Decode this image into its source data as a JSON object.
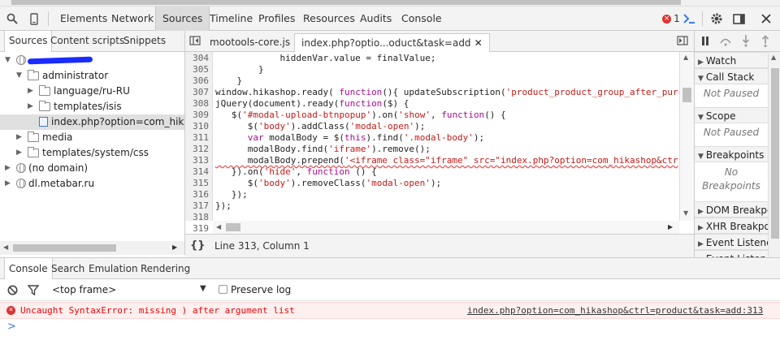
{
  "toolbar": {
    "tabs": [
      "Elements",
      "Network",
      "Sources",
      "Timeline",
      "Profiles",
      "Resources",
      "Audits",
      "Console"
    ],
    "active_tab": "Sources",
    "error_count": "1"
  },
  "navigator": {
    "tabs": [
      "Sources",
      "Content scripts",
      "Snippets"
    ],
    "tree": [
      {
        "label": "",
        "type": "globe",
        "indent": 0,
        "open": true,
        "redacted": true
      },
      {
        "label": "administrator",
        "type": "folder",
        "indent": 1,
        "open": true
      },
      {
        "label": "language/ru-RU",
        "type": "folder",
        "indent": 2,
        "open": false
      },
      {
        "label": "templates/isis",
        "type": "folder",
        "indent": 2,
        "open": false
      },
      {
        "label": "index.php?option=com_hikasho",
        "type": "file",
        "indent": 2,
        "selected": true
      },
      {
        "label": "media",
        "type": "folder",
        "indent": 1,
        "open": false
      },
      {
        "label": "templates/system/css",
        "type": "folder",
        "indent": 1,
        "open": false
      },
      {
        "label": "(no domain)",
        "type": "globe",
        "indent": 0,
        "open": false
      },
      {
        "label": "dl.metabar.ru",
        "type": "globe",
        "indent": 0,
        "open": false
      }
    ]
  },
  "editor": {
    "tabs": [
      "mootools-core.js",
      "index.php?optio...oduct&task=add"
    ],
    "active_tab_index": 1,
    "status": "Line 313, Column 1",
    "error_line": 313,
    "lines": [
      {
        "n": "304",
        "html": "            hiddenVar.value = finalValue;"
      },
      {
        "n": "305",
        "html": "        }"
      },
      {
        "n": "306",
        "html": "    }"
      },
      {
        "n": "307",
        "html": "window.hikashop.ready( <span class=\"kw\">function</span>(){ updateSubscription(<span class=\"str\">'product_product_group_after_purc</span>"
      },
      {
        "n": "308",
        "html": "jQuery(document).ready(<span class=\"kw\">function</span>($) {"
      },
      {
        "n": "309",
        "html": "   $(<span class=\"str\">'#modal-upload-btnpopup'</span>).on(<span class=\"str\">'show'</span>, <span class=\"kw\">function</span>() {"
      },
      {
        "n": "310",
        "html": "      $(<span class=\"str\">'body'</span>).addClass(<span class=\"str\">'modal-open'</span>);"
      },
      {
        "n": "311",
        "html": "      <span class=\"kw\">var</span> modalBody = $(<span class=\"kw\">this</span>).find(<span class=\"str\">'.modal-body'</span>);"
      },
      {
        "n": "312",
        "html": "      modalBody.find(<span class=\"str\">'iframe'</span>).remove();"
      },
      {
        "n": "313",
        "html": "      modalBody.prepend(<span class=\"str\">'&lt;iframe class=\"iframe\" src=\"index.php?option=com_hikashop&amp;ctr</span>"
      },
      {
        "n": "314",
        "html": "   }).on(<span class=\"str\">'hide'</span>, <span class=\"kw\">function</span> () {"
      },
      {
        "n": "315",
        "html": "      $(<span class=\"str\">'body'</span>).removeClass(<span class=\"str\">'modal-open'</span>);"
      },
      {
        "n": "316",
        "html": "   });"
      },
      {
        "n": "317",
        "html": "});"
      },
      {
        "n": "318",
        "html": ""
      },
      {
        "n": "319",
        "html": ""
      }
    ]
  },
  "debugger": {
    "sections": [
      {
        "title": "Watch",
        "body": "",
        "open": false
      },
      {
        "title": "Call Stack",
        "body": "Not Paused",
        "open": true
      },
      {
        "title": "Scope",
        "body": "Not Paused",
        "open": true
      },
      {
        "title": "Breakpoints",
        "body": "No Breakpoints",
        "open": true
      },
      {
        "title": "DOM Breakpo",
        "body": "",
        "open": false
      },
      {
        "title": "XHR Breakpoi",
        "body": "",
        "open": false
      },
      {
        "title": "Event Listener",
        "body": "",
        "open": false
      },
      {
        "title": "Event Listener",
        "body": "",
        "open": false
      }
    ]
  },
  "drawer": {
    "tabs": [
      "Console",
      "Search",
      "Emulation",
      "Rendering"
    ],
    "frame_select": "<top frame>",
    "preserve_log_label": "Preserve log",
    "error": {
      "message": "Uncaught SyntaxError: missing ) after argument list",
      "source": "index.php?option=com_hikashop&ctrl=product&task=add:313"
    },
    "prompt": ">"
  },
  "colors": {
    "error": "#e03030",
    "accent": "#367cf1"
  }
}
